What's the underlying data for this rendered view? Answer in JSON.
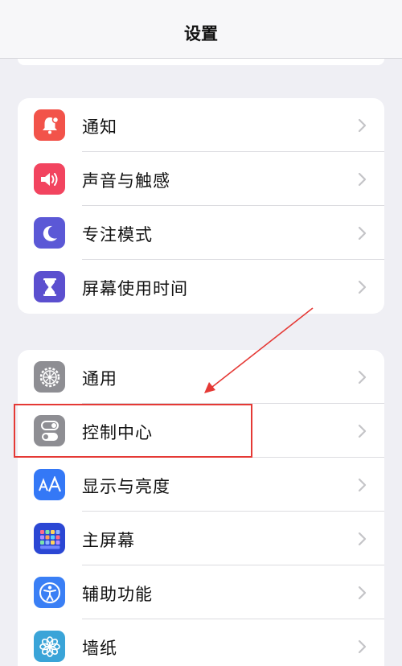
{
  "header": {
    "title": "设置"
  },
  "groups": [
    {
      "items": [
        {
          "label": "通知",
          "icon": "notification-bell-icon",
          "color": "#f2534a"
        },
        {
          "label": "声音与触感",
          "icon": "speaker-icon",
          "color": "#f2445f"
        },
        {
          "label": "专注模式",
          "icon": "moon-icon",
          "color": "#5b58d6"
        },
        {
          "label": "屏幕使用时间",
          "icon": "hourglass-icon",
          "color": "#5b4fcf"
        }
      ]
    },
    {
      "items": [
        {
          "label": "通用",
          "icon": "gear-icon",
          "color": "#8e8e93"
        },
        {
          "label": "控制中心",
          "icon": "toggles-icon",
          "color": "#8e8e93"
        },
        {
          "label": "显示与亮度",
          "icon": "text-size-icon",
          "color": "#3478f6"
        },
        {
          "label": "主屏幕",
          "icon": "app-grid-icon",
          "color": "#2b47d4"
        },
        {
          "label": "辅助功能",
          "icon": "accessibility-icon",
          "color": "#3a7ff5"
        },
        {
          "label": "墙纸",
          "icon": "flower-icon",
          "color": "#3aa4d8"
        }
      ]
    }
  ],
  "annotation": {
    "highlighted_item": "控制中心",
    "color": "#e53935"
  }
}
